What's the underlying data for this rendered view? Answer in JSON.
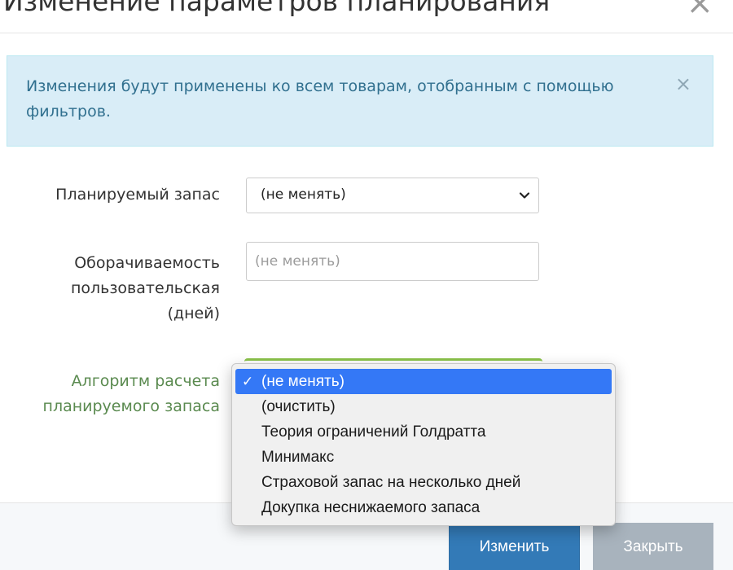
{
  "modal": {
    "title": "Изменение параметров планирования",
    "close_glyph": "×"
  },
  "alert": {
    "text": "Изменения будут применены ко всем товарам, отобранным с помощью фильтров.",
    "close_glyph": "×",
    "colors": {
      "background": "#d9edf7",
      "text": "#31708f"
    }
  },
  "form": {
    "planned_stock": {
      "label": "Планируемый запас",
      "selected": "(не менять)",
      "icon": "chevron-down-icon"
    },
    "turnover": {
      "label": "Оборачиваемость пользовательская (дней)",
      "placeholder": "(не менять)",
      "value": ""
    },
    "algorithm": {
      "label": "Алгоритм расчета планируемого запаса",
      "label_color": "#5a8a4f",
      "options": [
        "(не менять)",
        "(очистить)",
        "Теория ограничений Голдратта",
        "Минимакс",
        "Страховой запас на несколько дней",
        "Докупка неснижаемого запаса"
      ],
      "selected_index": 0,
      "check_glyph": "✓",
      "highlight_color": "#3478f6"
    }
  },
  "footer": {
    "apply_label": "Изменить",
    "close_label": "Закрыть",
    "colors": {
      "primary": "#337ab7",
      "secondary": "#a8b3bd"
    }
  }
}
